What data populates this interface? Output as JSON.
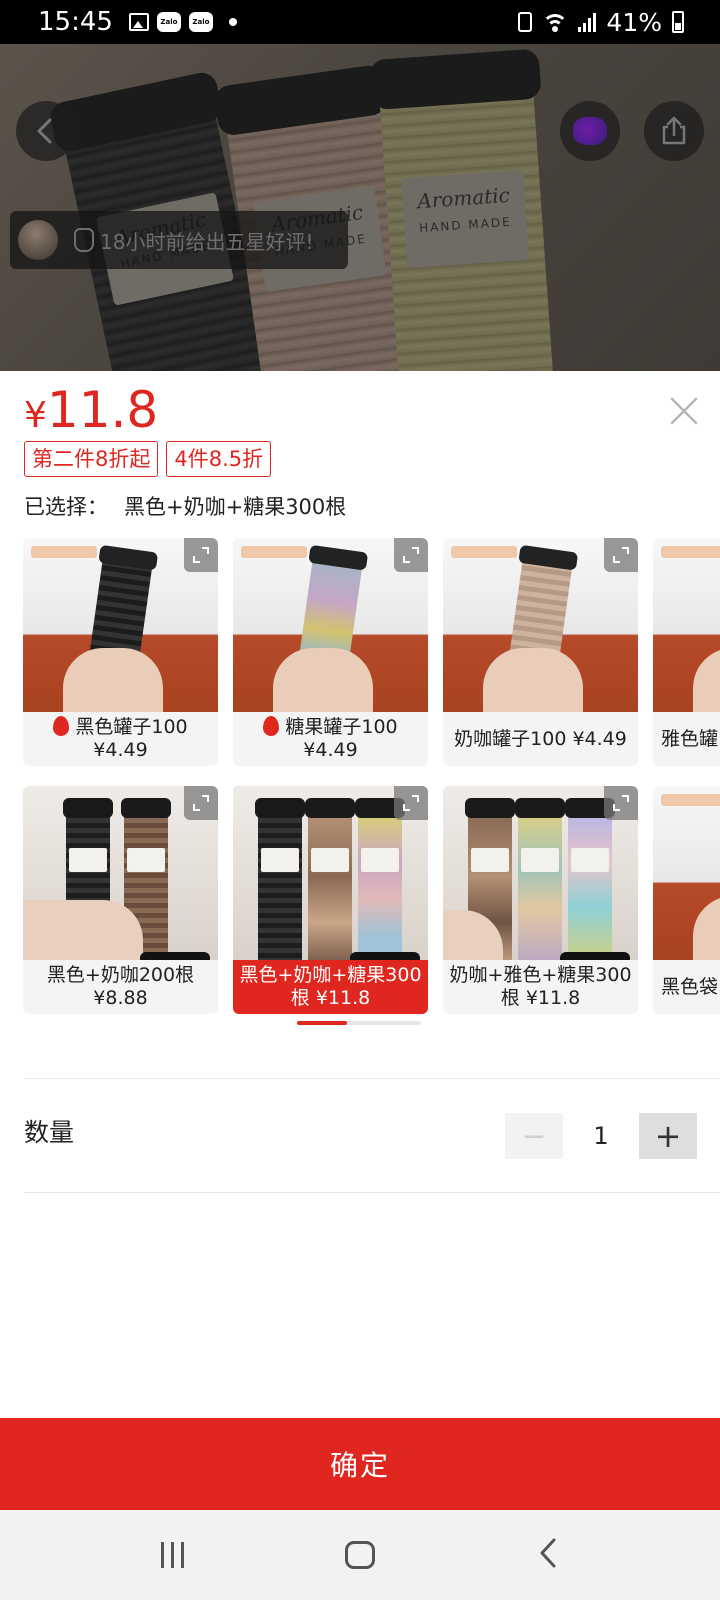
{
  "status_bar": {
    "time": "15:45",
    "zalo_label": "Zalo",
    "battery": "41%"
  },
  "banner": {
    "jar_brand": "Aromatic",
    "jar_sub": "HAND MADE",
    "review_text": "18小时前给出五星好评!"
  },
  "sheet": {
    "currency": "¥",
    "price": "11.8",
    "tags": [
      "第二件8折起",
      "4件8.5折"
    ],
    "selected_label": "已选择：",
    "selected_value": "黑色+奶咖+糖果300根",
    "variants_row1": [
      {
        "label": "黑色罐子100 ¥4.49",
        "hot": true
      },
      {
        "label": "糖果罐子100 ¥4.49",
        "hot": true
      },
      {
        "label": "奶咖罐子100 ¥4.49",
        "hot": false
      },
      {
        "label": "雅色罐",
        "hot": false
      }
    ],
    "variants_row2": [
      {
        "label": "黑色+奶咖200根 ¥8.88",
        "selected": false
      },
      {
        "label": "黑色+奶咖+糖果300根 ¥11.8",
        "selected": true
      },
      {
        "label": "奶咖+雅色+糖果300根 ¥11.8",
        "selected": false
      },
      {
        "label": "黑色袋",
        "selected": false
      }
    ],
    "quantity_label": "数量",
    "quantity_value": "1",
    "minus_glyph": "−",
    "plus_glyph": "+",
    "confirm_label": "确定"
  },
  "colors": {
    "accent": "#e0271f",
    "selected_card_bg": "#e0271f",
    "card_bg": "#f4f4f4"
  },
  "icons": {
    "back": "chevron-left-icon",
    "share": "share-icon",
    "close": "close-icon",
    "expand": "expand-icon",
    "hot": "flame-icon"
  }
}
